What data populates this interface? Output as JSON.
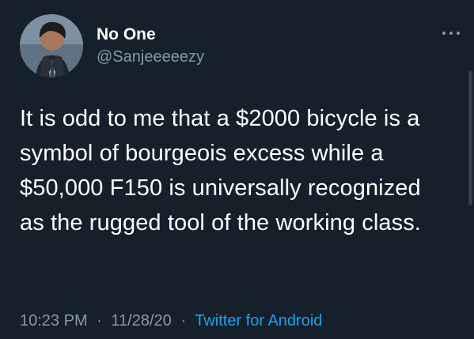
{
  "tweet": {
    "author_name": "No One",
    "author_handle": "@Sanjeeeeezy",
    "text": "It is odd to me that a $2000 bicycle is a symbol of bourgeois excess while a $50,000 F150 is universally recognized as the rugged tool of the working class.",
    "time": "10:23 PM",
    "date": "11/28/20",
    "source": "Twitter for Android",
    "separator": "·"
  },
  "icons": {
    "avatar": "profile-photo",
    "more": "more-options-icon"
  },
  "colors": {
    "background": "#15202b",
    "text_primary": "#ffffff",
    "text_secondary": "#8899a6",
    "link": "#1da1f2"
  }
}
